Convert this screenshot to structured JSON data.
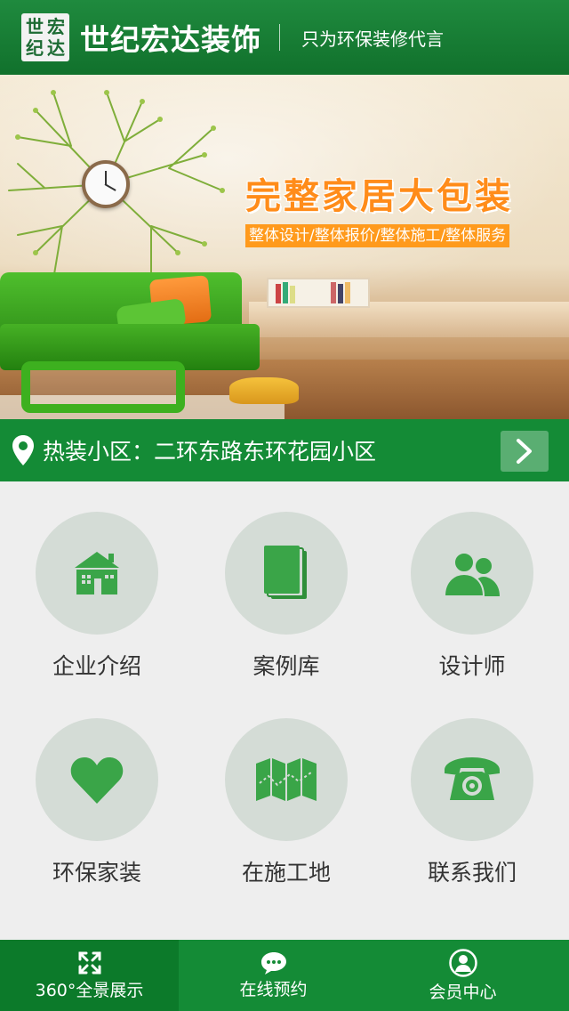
{
  "header": {
    "logo_chars": [
      "世",
      "宏",
      "纪",
      "达"
    ],
    "brand": "世纪宏达装饰",
    "slogan": "只为环保装修代言"
  },
  "banner": {
    "title": "完整家居大包装",
    "subtitle": "整体设计/整体报价/整体施工/整体服务"
  },
  "hot": {
    "label": "热装小区：二环东路东环花园小区",
    "icon": "location-pin-icon",
    "arrow_icon": "chevron-right-icon"
  },
  "grid": [
    {
      "label": "企业介绍",
      "icon": "house-icon"
    },
    {
      "label": "案例库",
      "icon": "book-icon"
    },
    {
      "label": "设计师",
      "icon": "people-icon"
    },
    {
      "label": "环保家装",
      "icon": "heart-icon"
    },
    {
      "label": "在施工地",
      "icon": "map-icon"
    },
    {
      "label": "联系我们",
      "icon": "telephone-icon"
    }
  ],
  "bottom_nav": [
    {
      "label": "360°全景展示",
      "icon": "expand-icon",
      "active": true
    },
    {
      "label": "在线预约",
      "icon": "chat-icon",
      "active": false
    },
    {
      "label": "会员中心",
      "icon": "user-icon",
      "active": false
    }
  ],
  "colors": {
    "brand_green": "#148b36",
    "icon_green": "#3aa548",
    "promo_orange": "#ff9a1c",
    "circle_bg": "#d4dcd6"
  }
}
